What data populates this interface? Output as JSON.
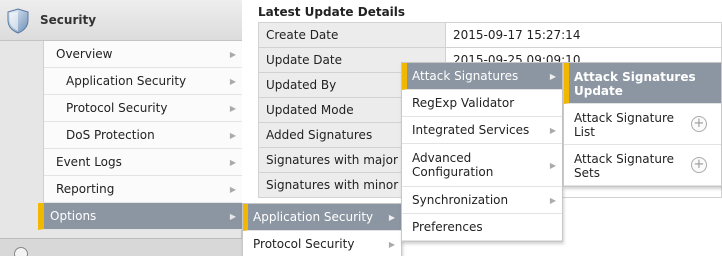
{
  "sidebar": {
    "title": "Security",
    "items": [
      {
        "label": "Overview",
        "arrow": "▶"
      },
      {
        "label": "Application Security",
        "arrow": "▶"
      },
      {
        "label": "Protocol Security",
        "arrow": "▶"
      },
      {
        "label": "DoS Protection",
        "arrow": "▶"
      },
      {
        "label": "Event Logs",
        "arrow": "▶"
      },
      {
        "label": "Reporting",
        "arrow": "▶"
      },
      {
        "label": "Options",
        "arrow": "▶"
      }
    ]
  },
  "details": {
    "title": "Latest Update Details",
    "rows": [
      {
        "label": "Create Date",
        "value": "2015-09-17 15:27:14"
      },
      {
        "label": "Update Date",
        "value": "2015-09-25 09:09:10"
      },
      {
        "label": "Updated By",
        "value": ""
      },
      {
        "label": "Updated Mode",
        "value": ""
      },
      {
        "label": "Added Signatures",
        "value": ""
      },
      {
        "label": "Signatures with major up",
        "value": ""
      },
      {
        "label": "Signatures with minor up",
        "value": ""
      }
    ]
  },
  "menu_level1": {
    "items": [
      {
        "label": "Application Security",
        "arrow": "▶"
      },
      {
        "label": "Protocol Security",
        "arrow": "▶"
      }
    ]
  },
  "menu_level2": {
    "items": [
      {
        "label": "Attack Signatures",
        "arrow": "▶"
      },
      {
        "label": "RegExp Validator"
      },
      {
        "label": "Integrated Services",
        "arrow": "▶"
      },
      {
        "line1": "Advanced",
        "line2": "Configuration",
        "arrow": "▶"
      },
      {
        "label": "Synchronization",
        "arrow": "▶"
      },
      {
        "label": "Preferences"
      }
    ]
  },
  "menu_level3": {
    "items": [
      {
        "line1": "Attack Signatures",
        "line2": "Update"
      },
      {
        "line1": "Attack Signature",
        "line2": "List",
        "plus": "+"
      },
      {
        "line1": "Attack Signature",
        "line2": "Sets",
        "plus": "+"
      }
    ]
  },
  "colors": {
    "active_bg": "#8c96a2",
    "accent": "#f2b700"
  }
}
